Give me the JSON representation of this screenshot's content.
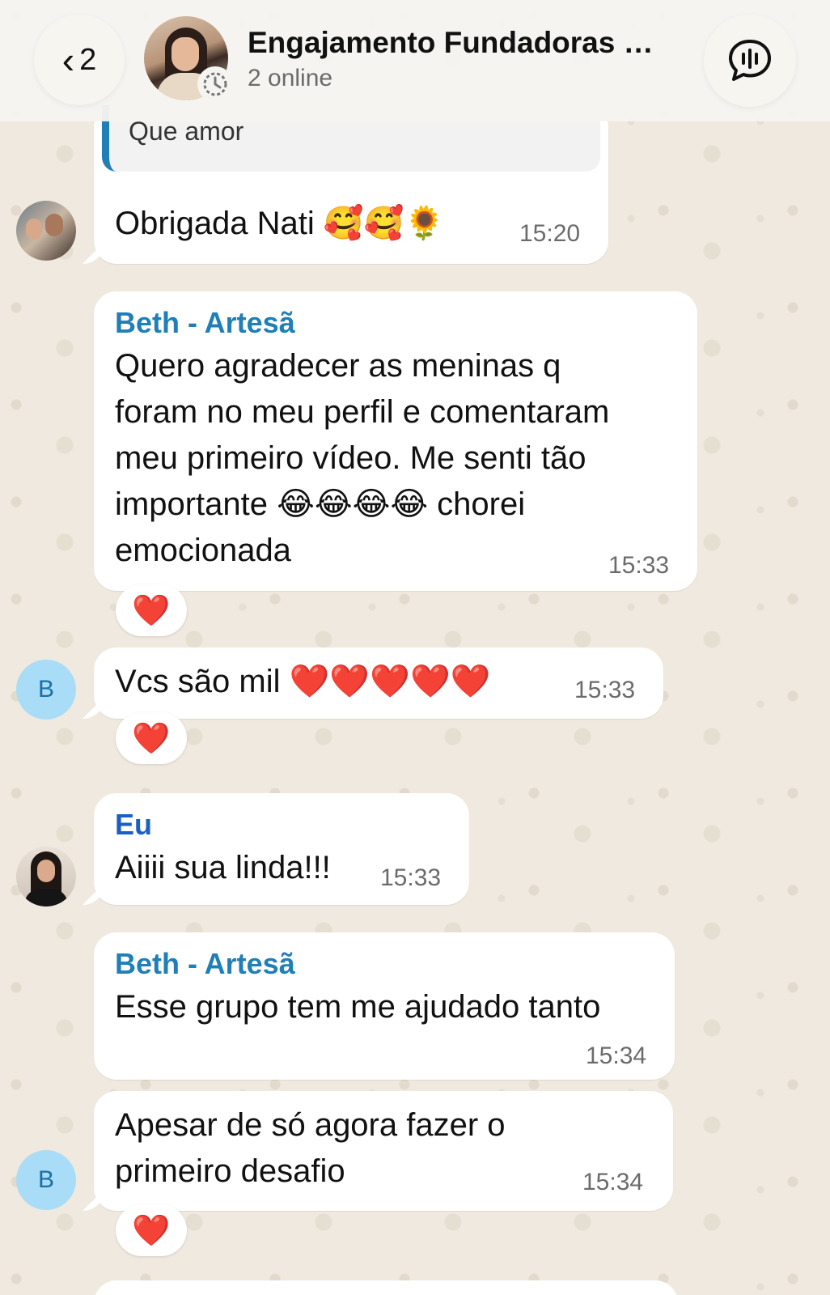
{
  "header": {
    "back_count": "2",
    "title": "Engajamento Fundadoras C...",
    "subtitle": "2 online",
    "colors": {
      "accent": "#1f7fb6",
      "eu": "#1c5fc4"
    }
  },
  "messages": [
    {
      "quote": "Que amor",
      "text": "Obrigada Nati 🥰🥰🌻",
      "time": "15:20"
    },
    {
      "sender": "Beth - Artesã",
      "lines": [
        "Quero agradecer as meninas q",
        "foram no meu perfil e comentaram",
        "meu primeiro vídeo. Me senti tão",
        "importante 😂😂😂😂 chorei",
        "emocionada"
      ],
      "time": "15:33",
      "reaction": "❤️"
    },
    {
      "avatar_letter": "B",
      "text": "Vcs são mil ❤️❤️❤️❤️❤️",
      "time": "15:33",
      "reaction": "❤️"
    },
    {
      "sender": "Eu",
      "text": "Aiiii sua linda!!!",
      "time": "15:33"
    },
    {
      "sender": "Beth - Artesã",
      "text": "Esse grupo tem me ajudado tanto",
      "time": "15:34"
    },
    {
      "avatar_letter": "B",
      "lines": [
        "Apesar de só agora fazer o",
        "primeiro desafio"
      ],
      "time": "15:34",
      "reaction": "❤️"
    }
  ]
}
